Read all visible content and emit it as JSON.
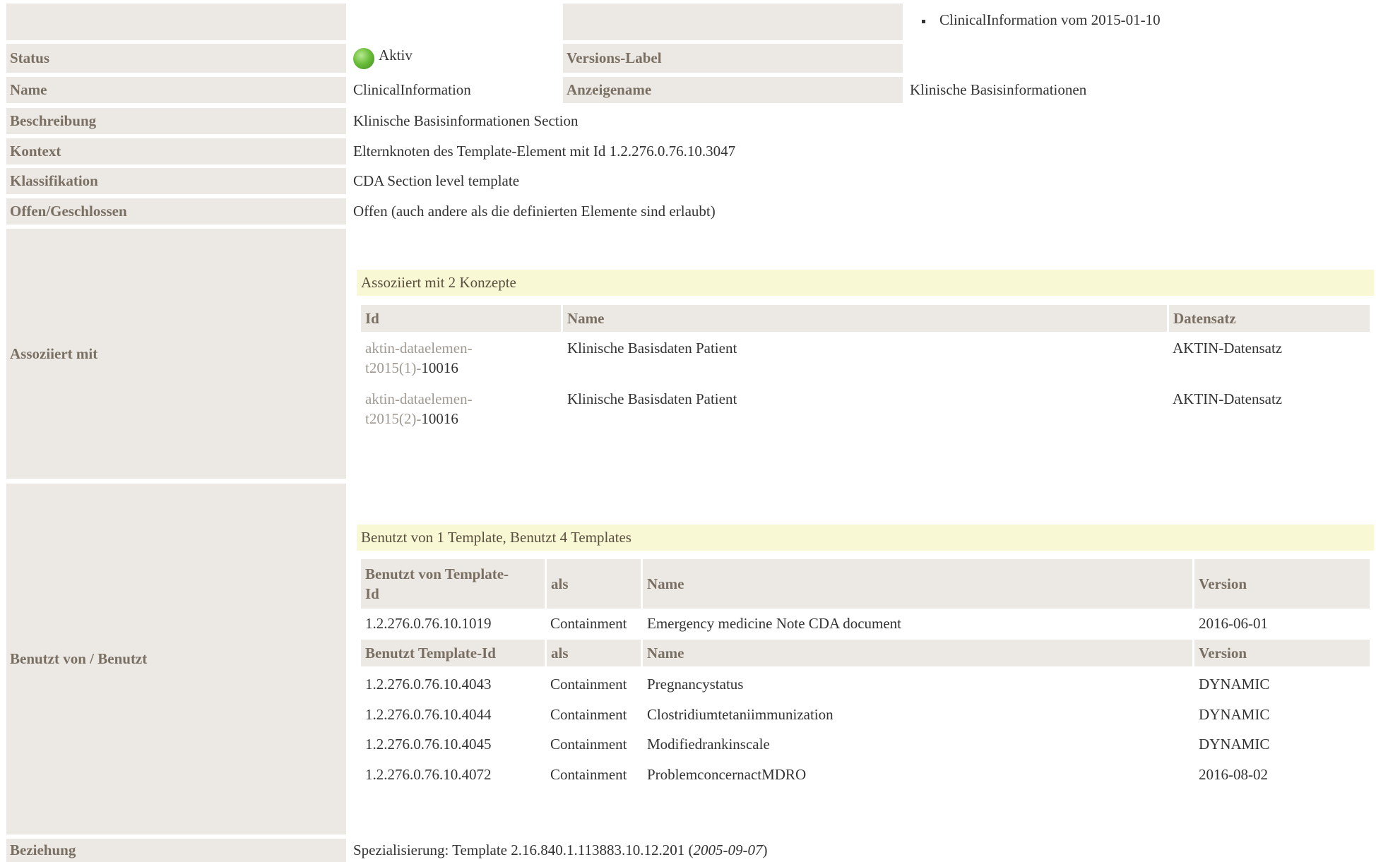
{
  "history": {
    "item": "ClinicalInformation vom 2015-01-10"
  },
  "status": {
    "label": "Status",
    "value": "Aktiv",
    "icon": "status-active-icon",
    "color": "#6cbf3b"
  },
  "versions_label": {
    "label": "Versions-Label",
    "value": ""
  },
  "name": {
    "label": "Name",
    "value": "ClinicalInformation"
  },
  "display_name": {
    "label": "Anzeigename",
    "value": "Klinische Basisinformationen"
  },
  "description": {
    "label": "Beschreibung",
    "value": "Klinische Basisinformationen Section"
  },
  "context": {
    "label": "Kontext",
    "value": "Elternknoten des Template-Element mit Id 1.2.276.0.76.10.3047"
  },
  "classification": {
    "label": "Klassifikation",
    "value": "CDA Section level template"
  },
  "open_closed": {
    "label": "Offen/Geschlossen",
    "value": "Offen (auch andere als die definierten Elemente sind erlaubt)"
  },
  "associated": {
    "label": "Assoziiert mit",
    "band": "Assoziiert mit 2 Konzepte",
    "headers": {
      "id": "Id",
      "name": "Name",
      "dataset": "Datensatz"
    },
    "rows": [
      {
        "id_prefix": "aktin-dataelemen-t2015(1)-",
        "id_suffix": "10016",
        "id_line1": "aktin-dataelemen-",
        "id_line2_gray": "t2015(1)-",
        "name": "Klinische Basisdaten Patient",
        "dataset": "AKTIN-Datensatz"
      },
      {
        "id_prefix": "aktin-dataelemen-t2015(2)-",
        "id_suffix": "10016",
        "id_line1": "aktin-dataelemen-",
        "id_line2_gray": "t2015(2)-",
        "name": "Klinische Basisdaten Patient",
        "dataset": "AKTIN-Datensatz"
      }
    ]
  },
  "used_by": {
    "label": "Benutzt von / Benutzt",
    "band": "Benutzt von 1 Template, Benutzt 4 Templates",
    "headers_by": {
      "id_line1": "Benutzt von Template-",
      "id_line2": "Id",
      "as": "als",
      "name": "Name",
      "version": "Version"
    },
    "rows_by": [
      {
        "id": "1.2.276.0.76.10.1019",
        "as": "Containment",
        "name": "Emergency medicine Note CDA document",
        "version": "2016-06-01"
      }
    ],
    "headers_uses": {
      "id": "Benutzt Template-Id",
      "as": "als",
      "name": "Name",
      "version": "Version"
    },
    "rows_uses": [
      {
        "id": "1.2.276.0.76.10.4043",
        "as": "Containment",
        "name": "Pregnancystatus",
        "version": "DYNAMIC"
      },
      {
        "id": "1.2.276.0.76.10.4044",
        "as": "Containment",
        "name": "Clostridiumtetaniimmunization",
        "version": "DYNAMIC"
      },
      {
        "id": "1.2.276.0.76.10.4045",
        "as": "Containment",
        "name": "Modifiedrankinscale",
        "version": "DYNAMIC"
      },
      {
        "id": "1.2.276.0.76.10.4072",
        "as": "Containment",
        "name": "ProblemconcernactMDRO",
        "version": "2016-08-02"
      }
    ]
  },
  "relationship": {
    "label": "Beziehung",
    "text": "Spezialisierung: Template 2.16.840.1.113883.10.12.201 (",
    "date": "2005-09-07",
    "close": ")"
  }
}
